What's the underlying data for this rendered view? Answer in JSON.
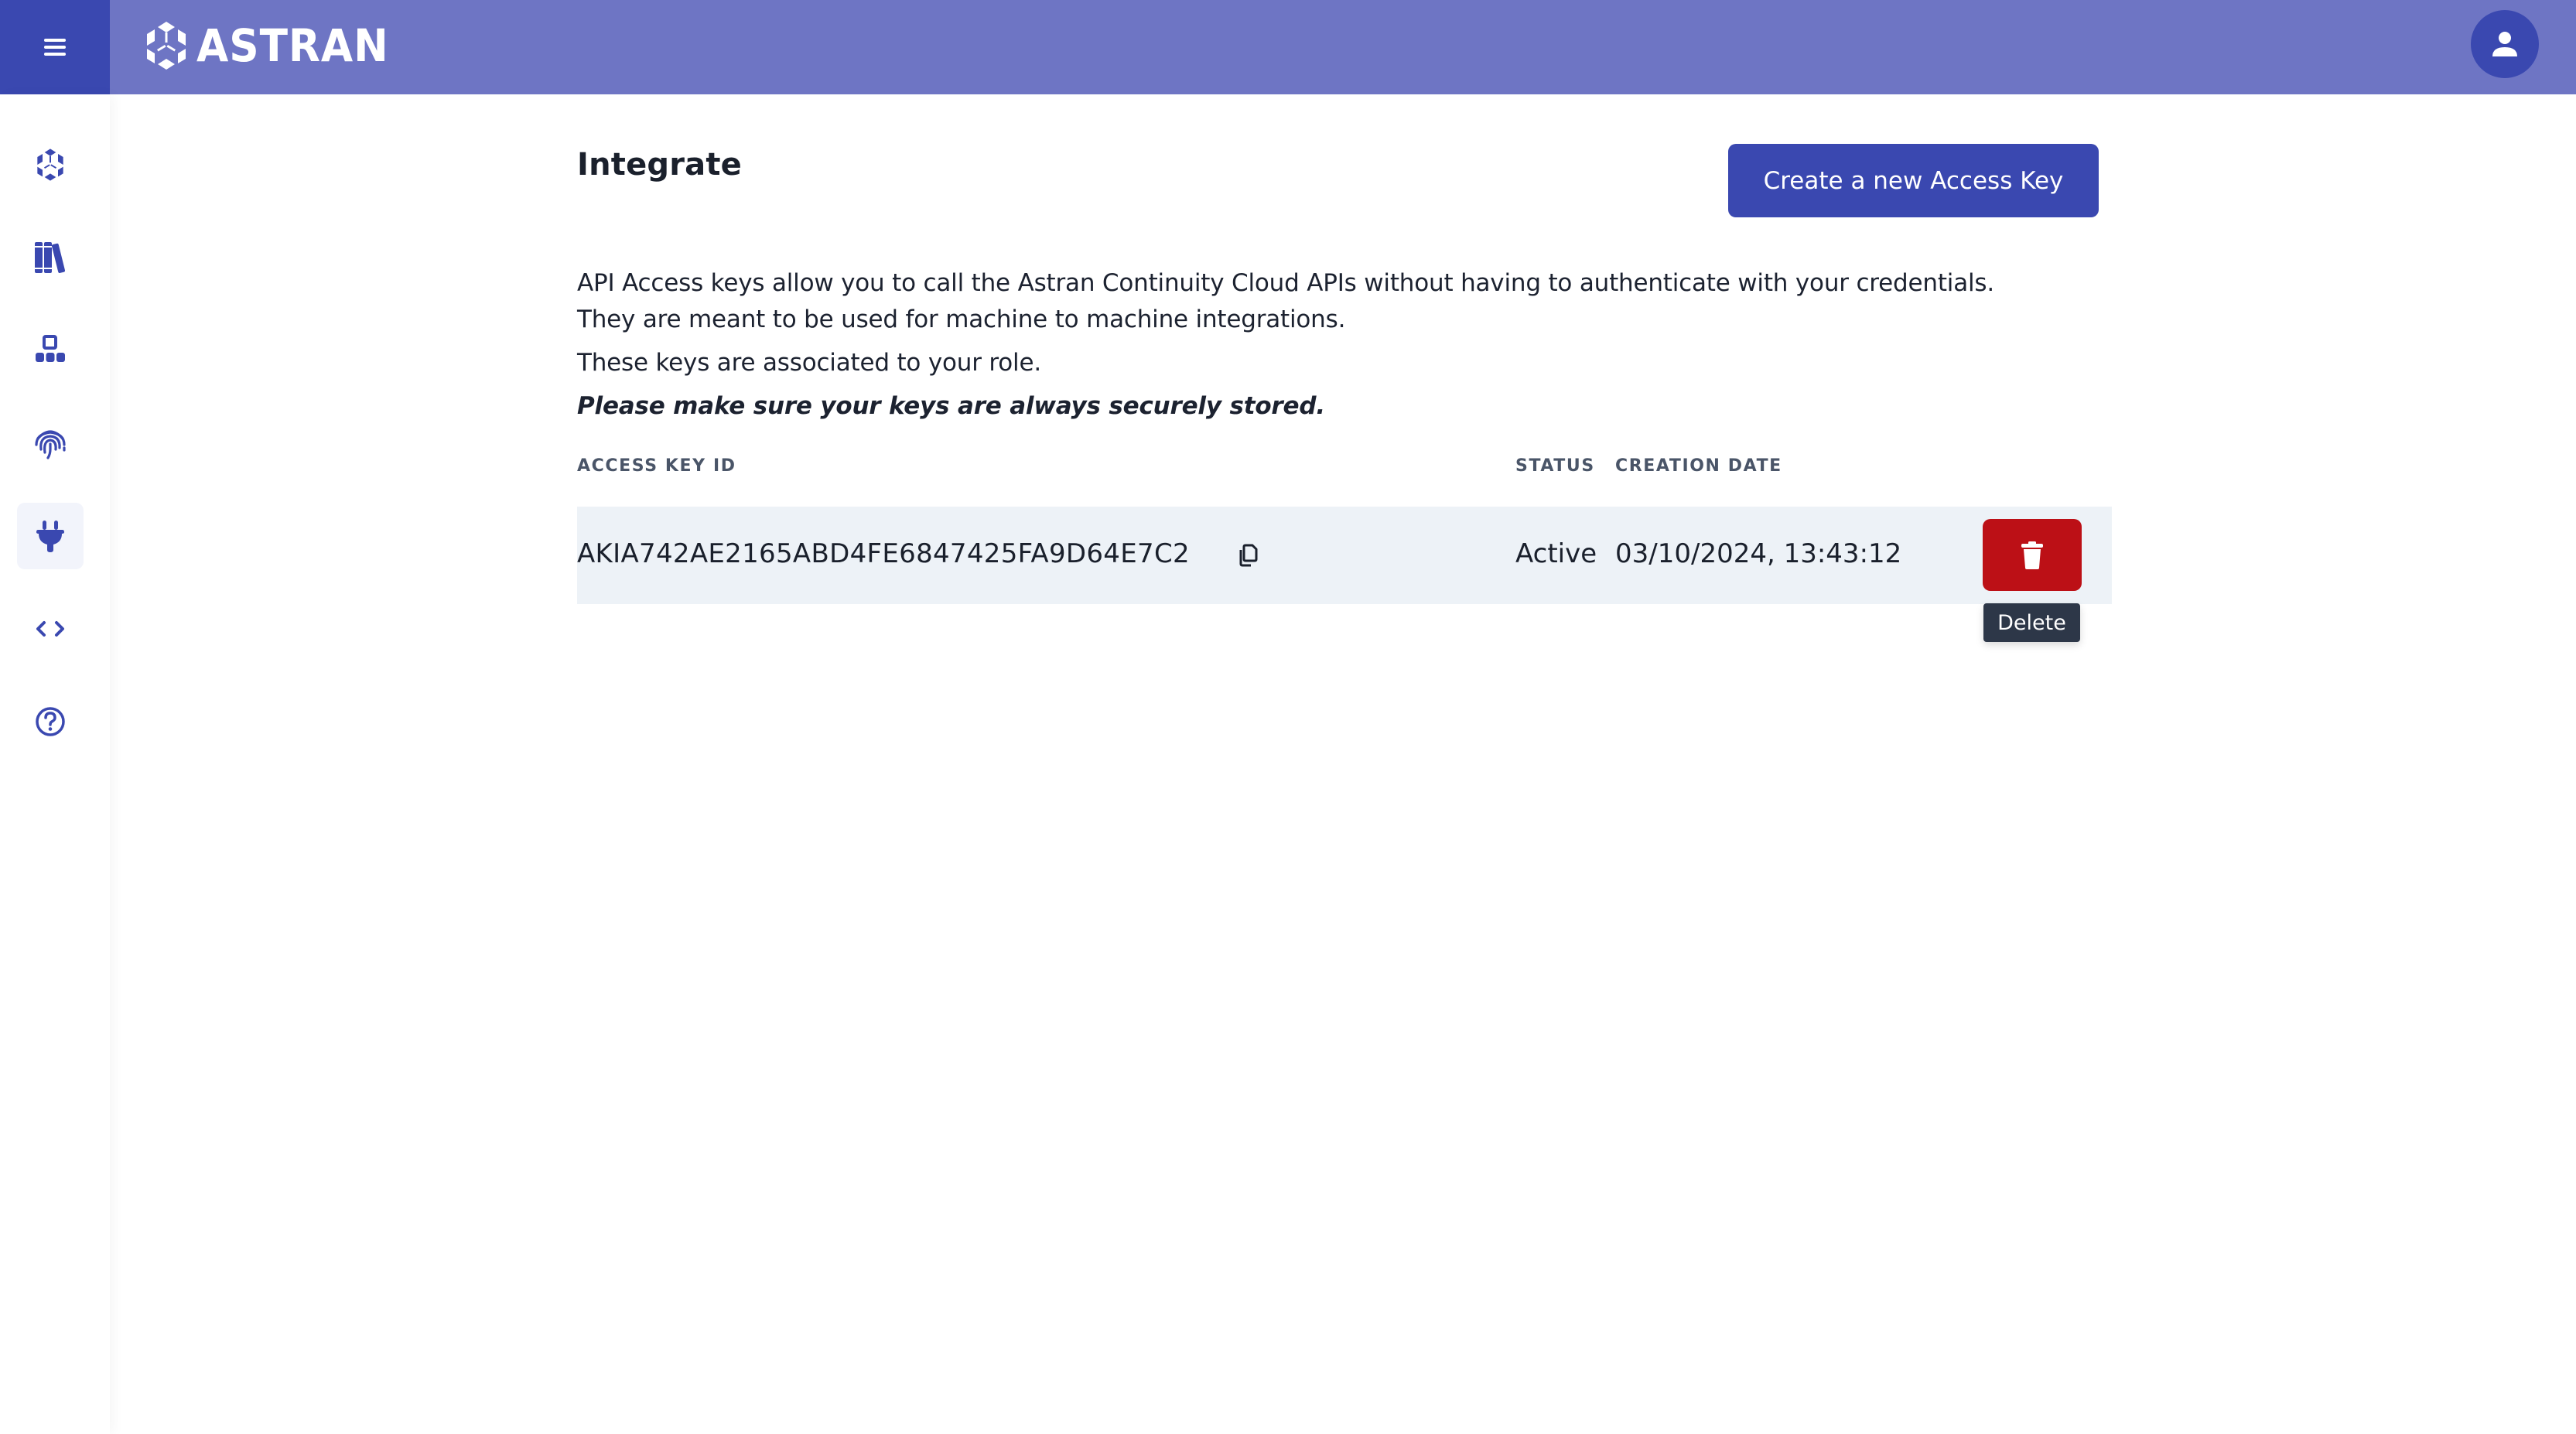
{
  "header": {
    "menu_icon": "hamburger-icon",
    "logo_icon": "astran-logo-icon",
    "logo_text": "ASTRAN",
    "avatar_icon": "user-icon",
    "colors": {
      "header_bg": "#6E75C4",
      "accent": "#3A48B0"
    }
  },
  "sidebar": {
    "items": [
      {
        "name": "home",
        "icon": "astran-cube-icon",
        "active": false
      },
      {
        "name": "library",
        "icon": "books-icon",
        "active": false
      },
      {
        "name": "organization",
        "icon": "hierarchy-icon",
        "active": false
      },
      {
        "name": "identity",
        "icon": "fingerprint-icon",
        "active": false
      },
      {
        "name": "integrate",
        "icon": "plug-icon",
        "active": true
      },
      {
        "name": "developer",
        "icon": "code-icon",
        "active": false
      },
      {
        "name": "help",
        "icon": "help-circle-icon",
        "active": false
      }
    ]
  },
  "main": {
    "title": "Integrate",
    "create_button_label": "Create a new Access Key",
    "description": {
      "line1": "API Access keys allow you to call the Astran Continuity Cloud APIs without having to authenticate with your credentials.",
      "line2": "They are meant to be used for machine to machine integrations.",
      "line3": "These keys are associated to your role.",
      "warning": "Please make sure your keys are always securely stored."
    },
    "table": {
      "columns": [
        "ACCESS KEY ID",
        "STATUS",
        "CREATION DATE"
      ],
      "rows": [
        {
          "access_key_id": "AKIA742AE2165ABD4FE6847425FA9D64E7C2",
          "status": "Active",
          "creation_date": "03/10/2024, 13:43:12",
          "copy_icon": "copy-icon",
          "delete_icon": "trash-icon"
        }
      ]
    },
    "tooltip": "Delete",
    "colors": {
      "row_bg": "#EDF2F7",
      "delete": "#BC1016",
      "tooltip_bg": "#2D3748"
    }
  }
}
